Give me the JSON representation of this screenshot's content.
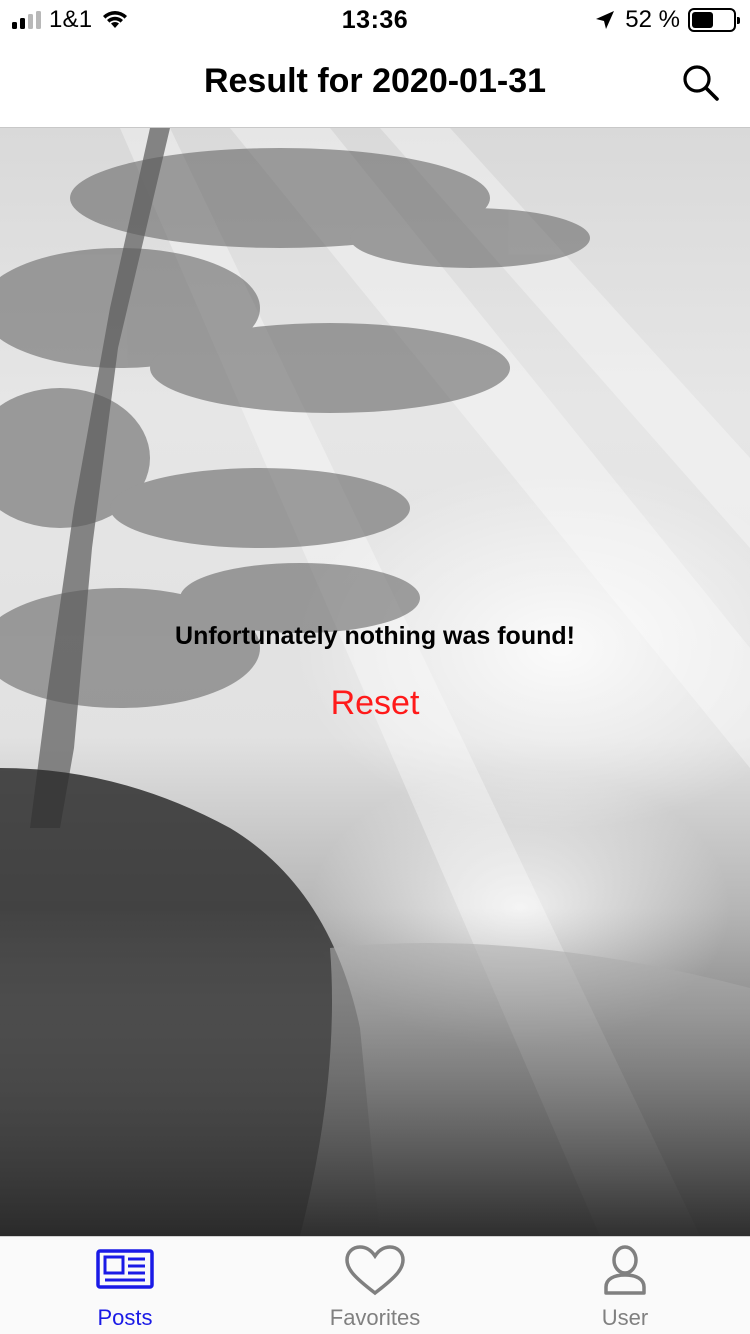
{
  "status_bar": {
    "carrier": "1&1",
    "time": "13:36",
    "battery_percent": "52 %",
    "battery_level": 0.52,
    "signal_bars_active": 2,
    "signal_bars_total": 4
  },
  "nav": {
    "title": "Result for 2020-01-31",
    "search_icon": "search-icon"
  },
  "main": {
    "empty_message": "Unfortunately nothing was found!",
    "reset_label": "Reset"
  },
  "tabs": [
    {
      "label": "Posts",
      "icon": "newspaper-icon",
      "active": true
    },
    {
      "label": "Favorites",
      "icon": "heart-icon",
      "active": false
    },
    {
      "label": "User",
      "icon": "user-icon",
      "active": false
    }
  ],
  "colors": {
    "accent": "#1a1ae6",
    "reset": "#ff1a1a",
    "inactive": "#808080"
  }
}
